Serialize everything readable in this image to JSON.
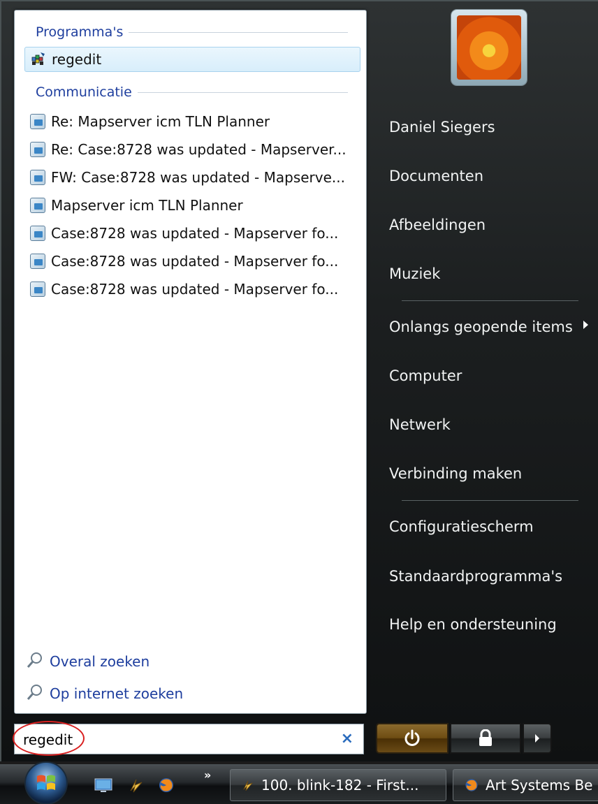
{
  "programs": {
    "header": "Programma's",
    "items": [
      {
        "label": "regedit",
        "icon": "regedit-icon",
        "selected": true
      }
    ]
  },
  "communication": {
    "header": "Communicatie",
    "items": [
      {
        "label": "Re: Mapserver icm TLN Planner",
        "icon": "mail-icon"
      },
      {
        "label": "Re: Case:8728 was updated - Mapserver...",
        "icon": "mail-icon"
      },
      {
        "label": "FW: Case:8728 was updated - Mapserve...",
        "icon": "mail-icon"
      },
      {
        "label": "Mapserver icm TLN Planner",
        "icon": "mail-icon"
      },
      {
        "label": "Case:8728 was updated - Mapserver fo...",
        "icon": "mail-icon"
      },
      {
        "label": "Case:8728 was updated - Mapserver fo...",
        "icon": "mail-icon"
      },
      {
        "label": "Case:8728 was updated - Mapserver fo...",
        "icon": "mail-icon"
      }
    ]
  },
  "search_links": {
    "everywhere": "Overal zoeken",
    "internet": "Op internet zoeken"
  },
  "search": {
    "value": "regedit"
  },
  "right_panel": {
    "user": "Daniel Siegers",
    "items": {
      "documents": "Documenten",
      "pictures": "Afbeeldingen",
      "music": "Muziek",
      "recent": "Onlangs geopende items",
      "computer": "Computer",
      "network": "Netwerk",
      "connect": "Verbinding maken",
      "control_panel": "Configuratiescherm",
      "default_programs": "Standaardprogramma's",
      "help": "Help en ondersteuning"
    }
  },
  "taskbar": {
    "overflow": "»",
    "buttons": [
      {
        "label": "100. blink-182 - First...",
        "icon": "winamp-icon"
      },
      {
        "label": "Art Systems Be",
        "icon": "firefox-icon"
      }
    ]
  },
  "colors": {
    "link_blue": "#1e3e9e",
    "power_orange": "#6e4d13",
    "search_circle_red": "#d92020"
  }
}
